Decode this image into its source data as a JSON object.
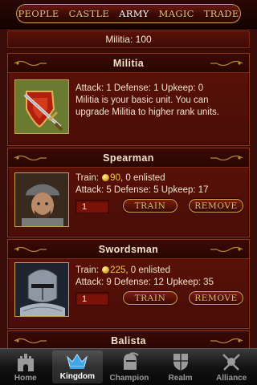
{
  "nav": {
    "tabs": [
      {
        "label": "PEOPLE",
        "active": false
      },
      {
        "label": "CASTLE",
        "active": false
      },
      {
        "label": "ARMY",
        "active": true
      },
      {
        "label": "MAGIC",
        "active": false
      },
      {
        "label": "TRADE",
        "active": false
      }
    ]
  },
  "summary": {
    "label": "Militia: 100"
  },
  "units": [
    {
      "name": "Militia",
      "stats": "Attack: 1 Defense: 1 Upkeep: 0",
      "description": "Militia is your basic unit. You can upgrade Militia to higher rank units.",
      "icon": "sword-shield-icon"
    },
    {
      "name": "Spearman",
      "train_prefix": "Train: ",
      "cost": "90",
      "enlisted": ", 0 enlisted",
      "stats": "Attack: 5 Defense: 5 Upkeep: 17",
      "quantity": "1",
      "train_label": "TRAIN",
      "remove_label": "REMOVE",
      "icon": "spearman-portrait"
    },
    {
      "name": "Swordsman",
      "train_prefix": "Train: ",
      "cost": "225",
      "enlisted": ", 0 enlisted",
      "stats": "Attack: 9 Defense: 12 Upkeep: 35",
      "quantity": "1",
      "train_label": "TRAIN",
      "remove_label": "REMOVE",
      "icon": "swordsman-portrait"
    },
    {
      "name": "Balista"
    }
  ],
  "tabbar": {
    "tabs": [
      {
        "label": "Home",
        "icon": "castle-icon",
        "active": false
      },
      {
        "label": "Kingdom",
        "icon": "crown-icon",
        "active": true
      },
      {
        "label": "Champion",
        "icon": "knight-helmet-icon",
        "active": false
      },
      {
        "label": "Realm",
        "icon": "shield-icon",
        "active": false
      },
      {
        "label": "Alliance",
        "icon": "crossed-swords-icon",
        "active": false
      }
    ]
  },
  "colors": {
    "background": "#3a0c07",
    "card": "#4f0e08",
    "gold": "#d0a24b",
    "coin": "#e0b22a"
  }
}
